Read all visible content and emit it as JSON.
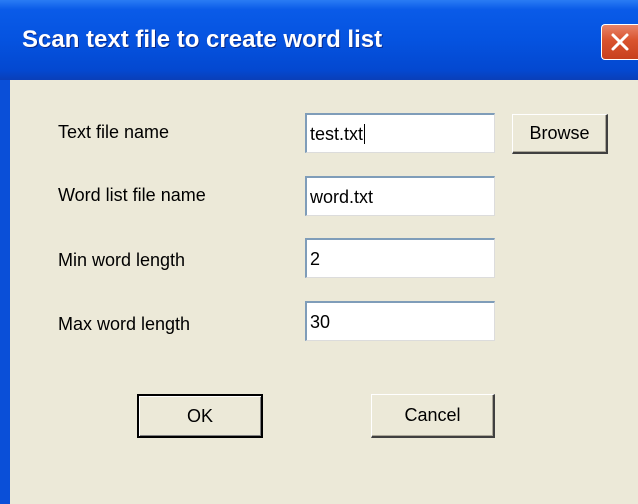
{
  "window": {
    "title": "Scan text file to create word list"
  },
  "form": {
    "fields": [
      {
        "label": "Text file name",
        "value": "test.txt"
      },
      {
        "label": "Word list file name",
        "value": "word.txt"
      },
      {
        "label": "Min word length",
        "value": "2"
      },
      {
        "label": "Max word length",
        "value": "30"
      }
    ]
  },
  "buttons": {
    "browse": "Browse",
    "ok": "OK",
    "cancel": "Cancel"
  },
  "icons": {
    "close": "close-icon"
  },
  "colors": {
    "title_bar": "#0553e0",
    "client_background": "#ece9d8",
    "close_button": "#d9532e"
  }
}
